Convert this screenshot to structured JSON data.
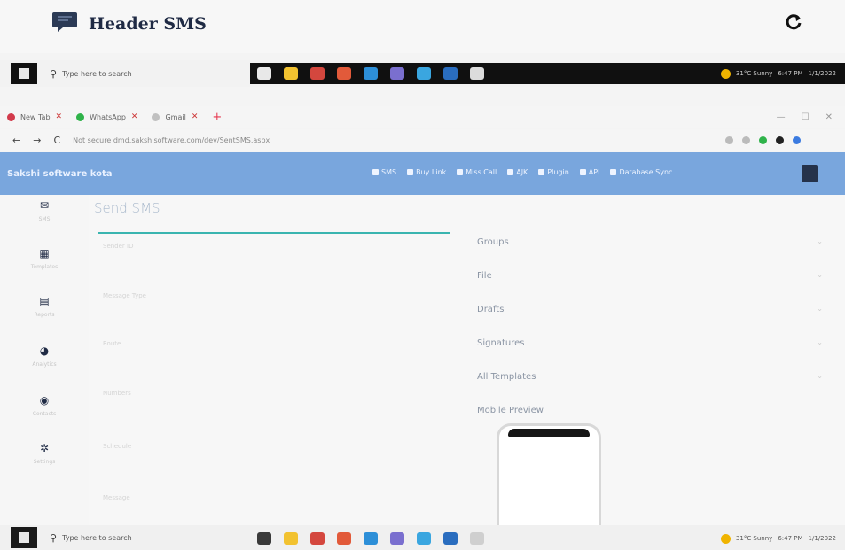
{
  "header": {
    "title": "Header SMS"
  },
  "taskbar": {
    "search_placeholder": "Type here to search",
    "weather": "31°C Sunny",
    "time_top": "6:47 PM",
    "date_top": "1/1/2022",
    "time_bottom": "6:47 PM",
    "date_bottom": "1/1/2022"
  },
  "browser": {
    "tabs": [
      {
        "label": "New Tab",
        "fav": "#d23a4b"
      },
      {
        "label": "WhatsApp",
        "fav": "#2fb34a"
      },
      {
        "label": "Gmail",
        "fav": "#c0c0c0"
      }
    ],
    "url": "Not secure  dmd.sakshisoftware.com/dev/SentSMS.aspx"
  },
  "appbar": {
    "brand": "Sakshi software kota",
    "nav": [
      "SMS",
      "Buy Link",
      "Miss Call",
      "AJK",
      "Plugin",
      "API",
      "Database Sync"
    ]
  },
  "sidebar": {
    "items": [
      {
        "icon": "✉",
        "label": "SMS"
      },
      {
        "icon": "▦",
        "label": "Templates"
      },
      {
        "icon": "▤",
        "label": "Reports"
      },
      {
        "icon": "◕",
        "label": "Analytics"
      },
      {
        "icon": "◉",
        "label": "Contacts"
      },
      {
        "icon": "✲",
        "label": "Settings"
      }
    ]
  },
  "main": {
    "title": "Send SMS",
    "fields": [
      "Sender ID",
      "Message Type",
      "Route",
      "Numbers",
      "Schedule",
      "Message"
    ],
    "panel": [
      "Groups",
      "File",
      "Drafts",
      "Signatures",
      "All Templates",
      "Mobile Preview"
    ]
  }
}
